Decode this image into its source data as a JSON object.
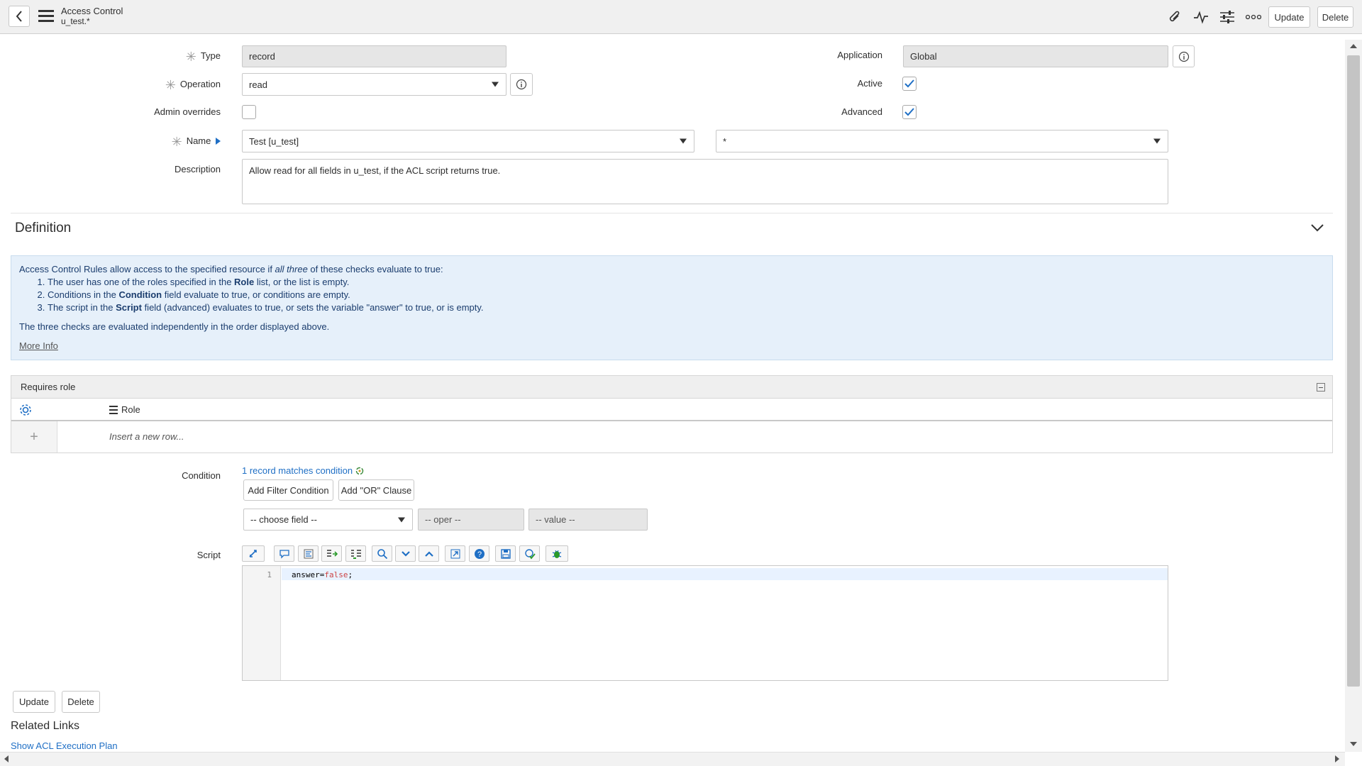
{
  "header": {
    "title": "Access Control",
    "subtitle": "u_test.*",
    "update_label": "Update",
    "delete_label": "Delete"
  },
  "form": {
    "type": {
      "label": "Type",
      "value": "record"
    },
    "operation": {
      "label": "Operation",
      "value": "read"
    },
    "admin_overrides": {
      "label": "Admin overrides",
      "checked": false
    },
    "name": {
      "label": "Name",
      "table": "Test [u_test]",
      "field": "*"
    },
    "description": {
      "label": "Description",
      "value": "Allow read for all fields in u_test, if the ACL script returns true."
    },
    "application": {
      "label": "Application",
      "value": "Global"
    },
    "active": {
      "label": "Active",
      "checked": true
    },
    "advanced": {
      "label": "Advanced",
      "checked": true
    }
  },
  "definition": {
    "title": "Definition",
    "intro_before": "Access Control Rules allow access to the specified resource if ",
    "intro_em": "all three",
    "intro_after": " of these checks evaluate to true:",
    "items": [
      {
        "before": "The user has one of the roles specified in the ",
        "bold": "Role",
        "after": " list, or the list is empty."
      },
      {
        "before": "Conditions in the ",
        "bold": "Condition",
        "after": " field evaluate to true, or conditions are empty."
      },
      {
        "before": "The script in the ",
        "bold": "Script",
        "after": " field (advanced) evaluates to true, or sets the variable \"answer\" to true, or is empty."
      }
    ],
    "note": "The three checks are evaluated independently in the order displayed above.",
    "more_info": "More Info"
  },
  "requires_role": {
    "title": "Requires role",
    "column": "Role",
    "insert_row": "Insert a new row..."
  },
  "condition": {
    "label": "Condition",
    "matches": "1 record matches condition",
    "add_filter": "Add Filter Condition",
    "add_or": "Add \"OR\" Clause",
    "field_placeholder": "-- choose field --",
    "oper_placeholder": "-- oper --",
    "value_placeholder": "-- value --"
  },
  "script": {
    "label": "Script",
    "line_no": "1",
    "code_var": "answer",
    "code_op": "=",
    "code_kw": "false",
    "code_end": ";"
  },
  "footer": {
    "update_label": "Update",
    "delete_label": "Delete",
    "related_links_title": "Related Links",
    "acl_plan_link": "Show ACL Execution Plan"
  },
  "colors": {
    "accent": "#1f6fc5",
    "info_bg": "#e6f0fa",
    "keyword": "#c44"
  }
}
